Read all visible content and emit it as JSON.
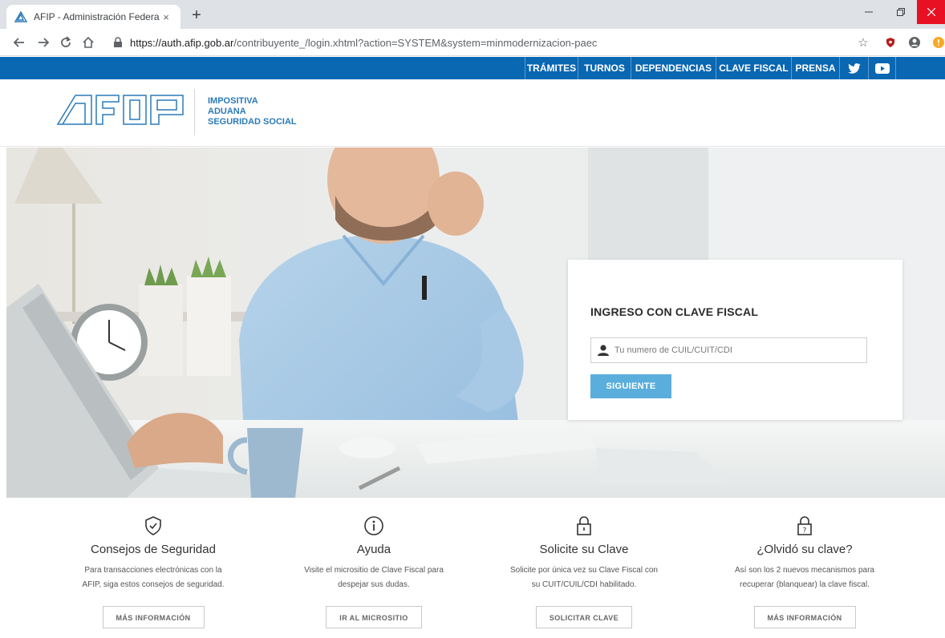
{
  "browser": {
    "tab_title": "AFIP - Administración Federal",
    "tab_close": "×",
    "new_tab": "+",
    "url_host": "https://auth.afip.gob.ar",
    "url_path": "/contribuyente_/login.xhtml?action=SYSTEM&system=minmodernizacion-paec"
  },
  "topnav": {
    "items": [
      "TRÁMITES",
      "TURNOS",
      "DEPENDENCIAS",
      "CLAVE FISCAL",
      "PRENSA"
    ],
    "social": [
      "twitter-icon",
      "youtube-icon"
    ],
    "color": "#0a67b2"
  },
  "header": {
    "brand_lines": [
      "IMPOSITIVA",
      "ADUANA",
      "SEGURIDAD SOCIAL"
    ]
  },
  "login": {
    "title": "INGRESO CON CLAVE FISCAL",
    "input_placeholder": "Tu numero de CUIL/CUIT/CDI",
    "button_label": "SIGUIENTE",
    "button_color": "#5aaedc"
  },
  "features": [
    {
      "icon": "shield-check-icon",
      "title": "Consejos de Seguridad",
      "desc_line1": "Para transacciones electrónicas con la",
      "desc_line2": "AFIP, siga estos consejos de seguridad.",
      "button": "MÁS INFORMACIÓN"
    },
    {
      "icon": "info-icon",
      "title": "Ayuda",
      "desc_line1": "Visite el micrositio de Clave Fiscal para",
      "desc_line2": "despejar sus dudas.",
      "button": "IR AL MICROSITIO"
    },
    {
      "icon": "lock-icon",
      "title": "Solicite su Clave",
      "desc_line1": "Solicite por única vez su Clave Fiscal con",
      "desc_line2": "su CUIT/CUIL/CDI habilitado.",
      "button": "SOLICITAR CLAVE"
    },
    {
      "icon": "lock-question-icon",
      "title": "¿Olvidó su clave?",
      "desc_line1": "Así son los 2 nuevos mecanismos para",
      "desc_line2": "recuperar (blanquear) la clave fiscal.",
      "button": "MÁS INFORMACIÓN"
    }
  ]
}
